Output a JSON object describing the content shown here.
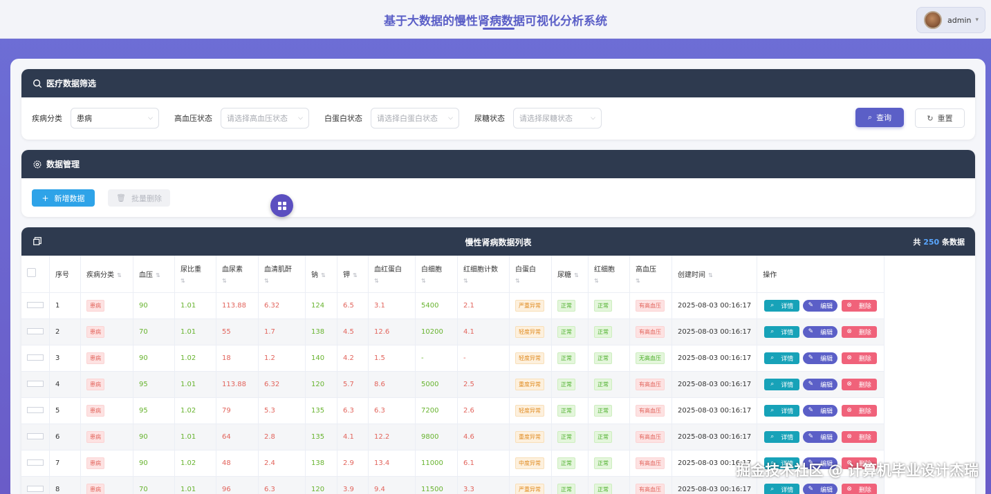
{
  "header": {
    "title": "基于大数据的慢性肾病数据可视化分析系统",
    "user": "admin"
  },
  "filter": {
    "title": "医疗数据筛选",
    "fields": [
      {
        "label": "疾病分类",
        "value": "患病",
        "placeholder": ""
      },
      {
        "label": "高血压状态",
        "value": "",
        "placeholder": "请选择高血压状态"
      },
      {
        "label": "白蛋白状态",
        "value": "",
        "placeholder": "请选择白蛋白状态"
      },
      {
        "label": "尿糖状态",
        "value": "",
        "placeholder": "请选择尿糖状态"
      }
    ],
    "query_label": "查询",
    "reset_label": "重置"
  },
  "manage": {
    "title": "数据管理",
    "add_label": "新增数据",
    "batch_delete_label": "批量删除"
  },
  "table": {
    "title": "慢性肾病数据列表",
    "total_prefix": "共",
    "total": "250",
    "total_suffix": "条数据",
    "columns": [
      "序号",
      "疾病分类",
      "血压",
      "尿比重",
      "血尿素",
      "血清肌酐",
      "钠",
      "钾",
      "血红蛋白",
      "白细胞",
      "红细胞计数",
      "白蛋白",
      "尿糖",
      "红细胞",
      "高血压",
      "创建时间",
      "操作"
    ],
    "actions": {
      "detail": "详情",
      "edit": "编辑",
      "delete": "删除"
    },
    "rows": [
      {
        "idx": "1",
        "cls": "患病",
        "bp": "90",
        "sg": "1.01",
        "bu": "113.88",
        "sc": "6.32",
        "sod": "124",
        "pot": "6.5",
        "hemo": "3.1",
        "wbc": "5400",
        "rbcc": "2.1",
        "al": "严重异常",
        "al_c": "orange",
        "su": "正常",
        "rbc": "正常",
        "htn": "有高血压",
        "time": "2025-08-03 00:16:17"
      },
      {
        "idx": "2",
        "cls": "患病",
        "bp": "70",
        "sg": "1.01",
        "bu": "55",
        "sc": "1.7",
        "sod": "138",
        "pot": "4.5",
        "hemo": "12.6",
        "wbc": "10200",
        "rbcc": "4.1",
        "al": "轻度异常",
        "al_c": "orange",
        "su": "正常",
        "rbc": "正常",
        "htn": "有高血压",
        "time": "2025-08-03 00:16:17"
      },
      {
        "idx": "3",
        "cls": "患病",
        "bp": "90",
        "sg": "1.02",
        "bu": "18",
        "sc": "1.2",
        "sod": "140",
        "pot": "4.2",
        "hemo": "1.5",
        "wbc": "-",
        "rbcc": "-",
        "al": "轻度异常",
        "al_c": "orange",
        "su": "正常",
        "rbc": "正常",
        "htn": "无高血压",
        "time": "2025-08-03 00:16:17"
      },
      {
        "idx": "4",
        "cls": "患病",
        "bp": "95",
        "sg": "1.01",
        "bu": "113.88",
        "sc": "6.32",
        "sod": "120",
        "pot": "5.7",
        "hemo": "8.6",
        "wbc": "5000",
        "rbcc": "2.5",
        "al": "重度异常",
        "al_c": "orange",
        "su": "正常",
        "rbc": "正常",
        "htn": "有高血压",
        "time": "2025-08-03 00:16:17"
      },
      {
        "idx": "5",
        "cls": "患病",
        "bp": "95",
        "sg": "1.02",
        "bu": "79",
        "sc": "5.3",
        "sod": "135",
        "pot": "6.3",
        "hemo": "6.3",
        "wbc": "7200",
        "rbcc": "2.6",
        "al": "轻度异常",
        "al_c": "orange",
        "su": "正常",
        "rbc": "正常",
        "htn": "有高血压",
        "time": "2025-08-03 00:16:17"
      },
      {
        "idx": "6",
        "cls": "患病",
        "bp": "90",
        "sg": "1.01",
        "bu": "64",
        "sc": "2.8",
        "sod": "135",
        "pot": "4.1",
        "hemo": "12.2",
        "wbc": "9800",
        "rbcc": "4.6",
        "al": "重度异常",
        "al_c": "orange",
        "su": "正常",
        "rbc": "正常",
        "htn": "有高血压",
        "time": "2025-08-03 00:16:17"
      },
      {
        "idx": "7",
        "cls": "患病",
        "bp": "90",
        "sg": "1.02",
        "bu": "48",
        "sc": "2.4",
        "sod": "138",
        "pot": "2.9",
        "hemo": "13.4",
        "wbc": "11000",
        "rbcc": "6.1",
        "al": "中度异常",
        "al_c": "orange",
        "su": "正常",
        "rbc": "正常",
        "htn": "有高血压",
        "time": "2025-08-03 00:16:17"
      },
      {
        "idx": "8",
        "cls": "患病",
        "bp": "70",
        "sg": "1.01",
        "bu": "96",
        "sc": "6.3",
        "sod": "120",
        "pot": "3.9",
        "hemo": "9.4",
        "wbc": "11500",
        "rbcc": "3.3",
        "al": "严重异常",
        "al_c": "orange",
        "su": "正常",
        "rbc": "正常",
        "htn": "有高血压",
        "time": "2025-08-03 00:16:17"
      }
    ]
  },
  "watermark": "掘金技术社区 @ 计算机毕业设计杰瑞",
  "colors": {
    "accent": "#5b5fc7",
    "header_dark": "#2e3a4f",
    "add_blue": "#2ea3e8",
    "detail_teal": "#17a2b8",
    "delete_pink": "#f0627a"
  }
}
